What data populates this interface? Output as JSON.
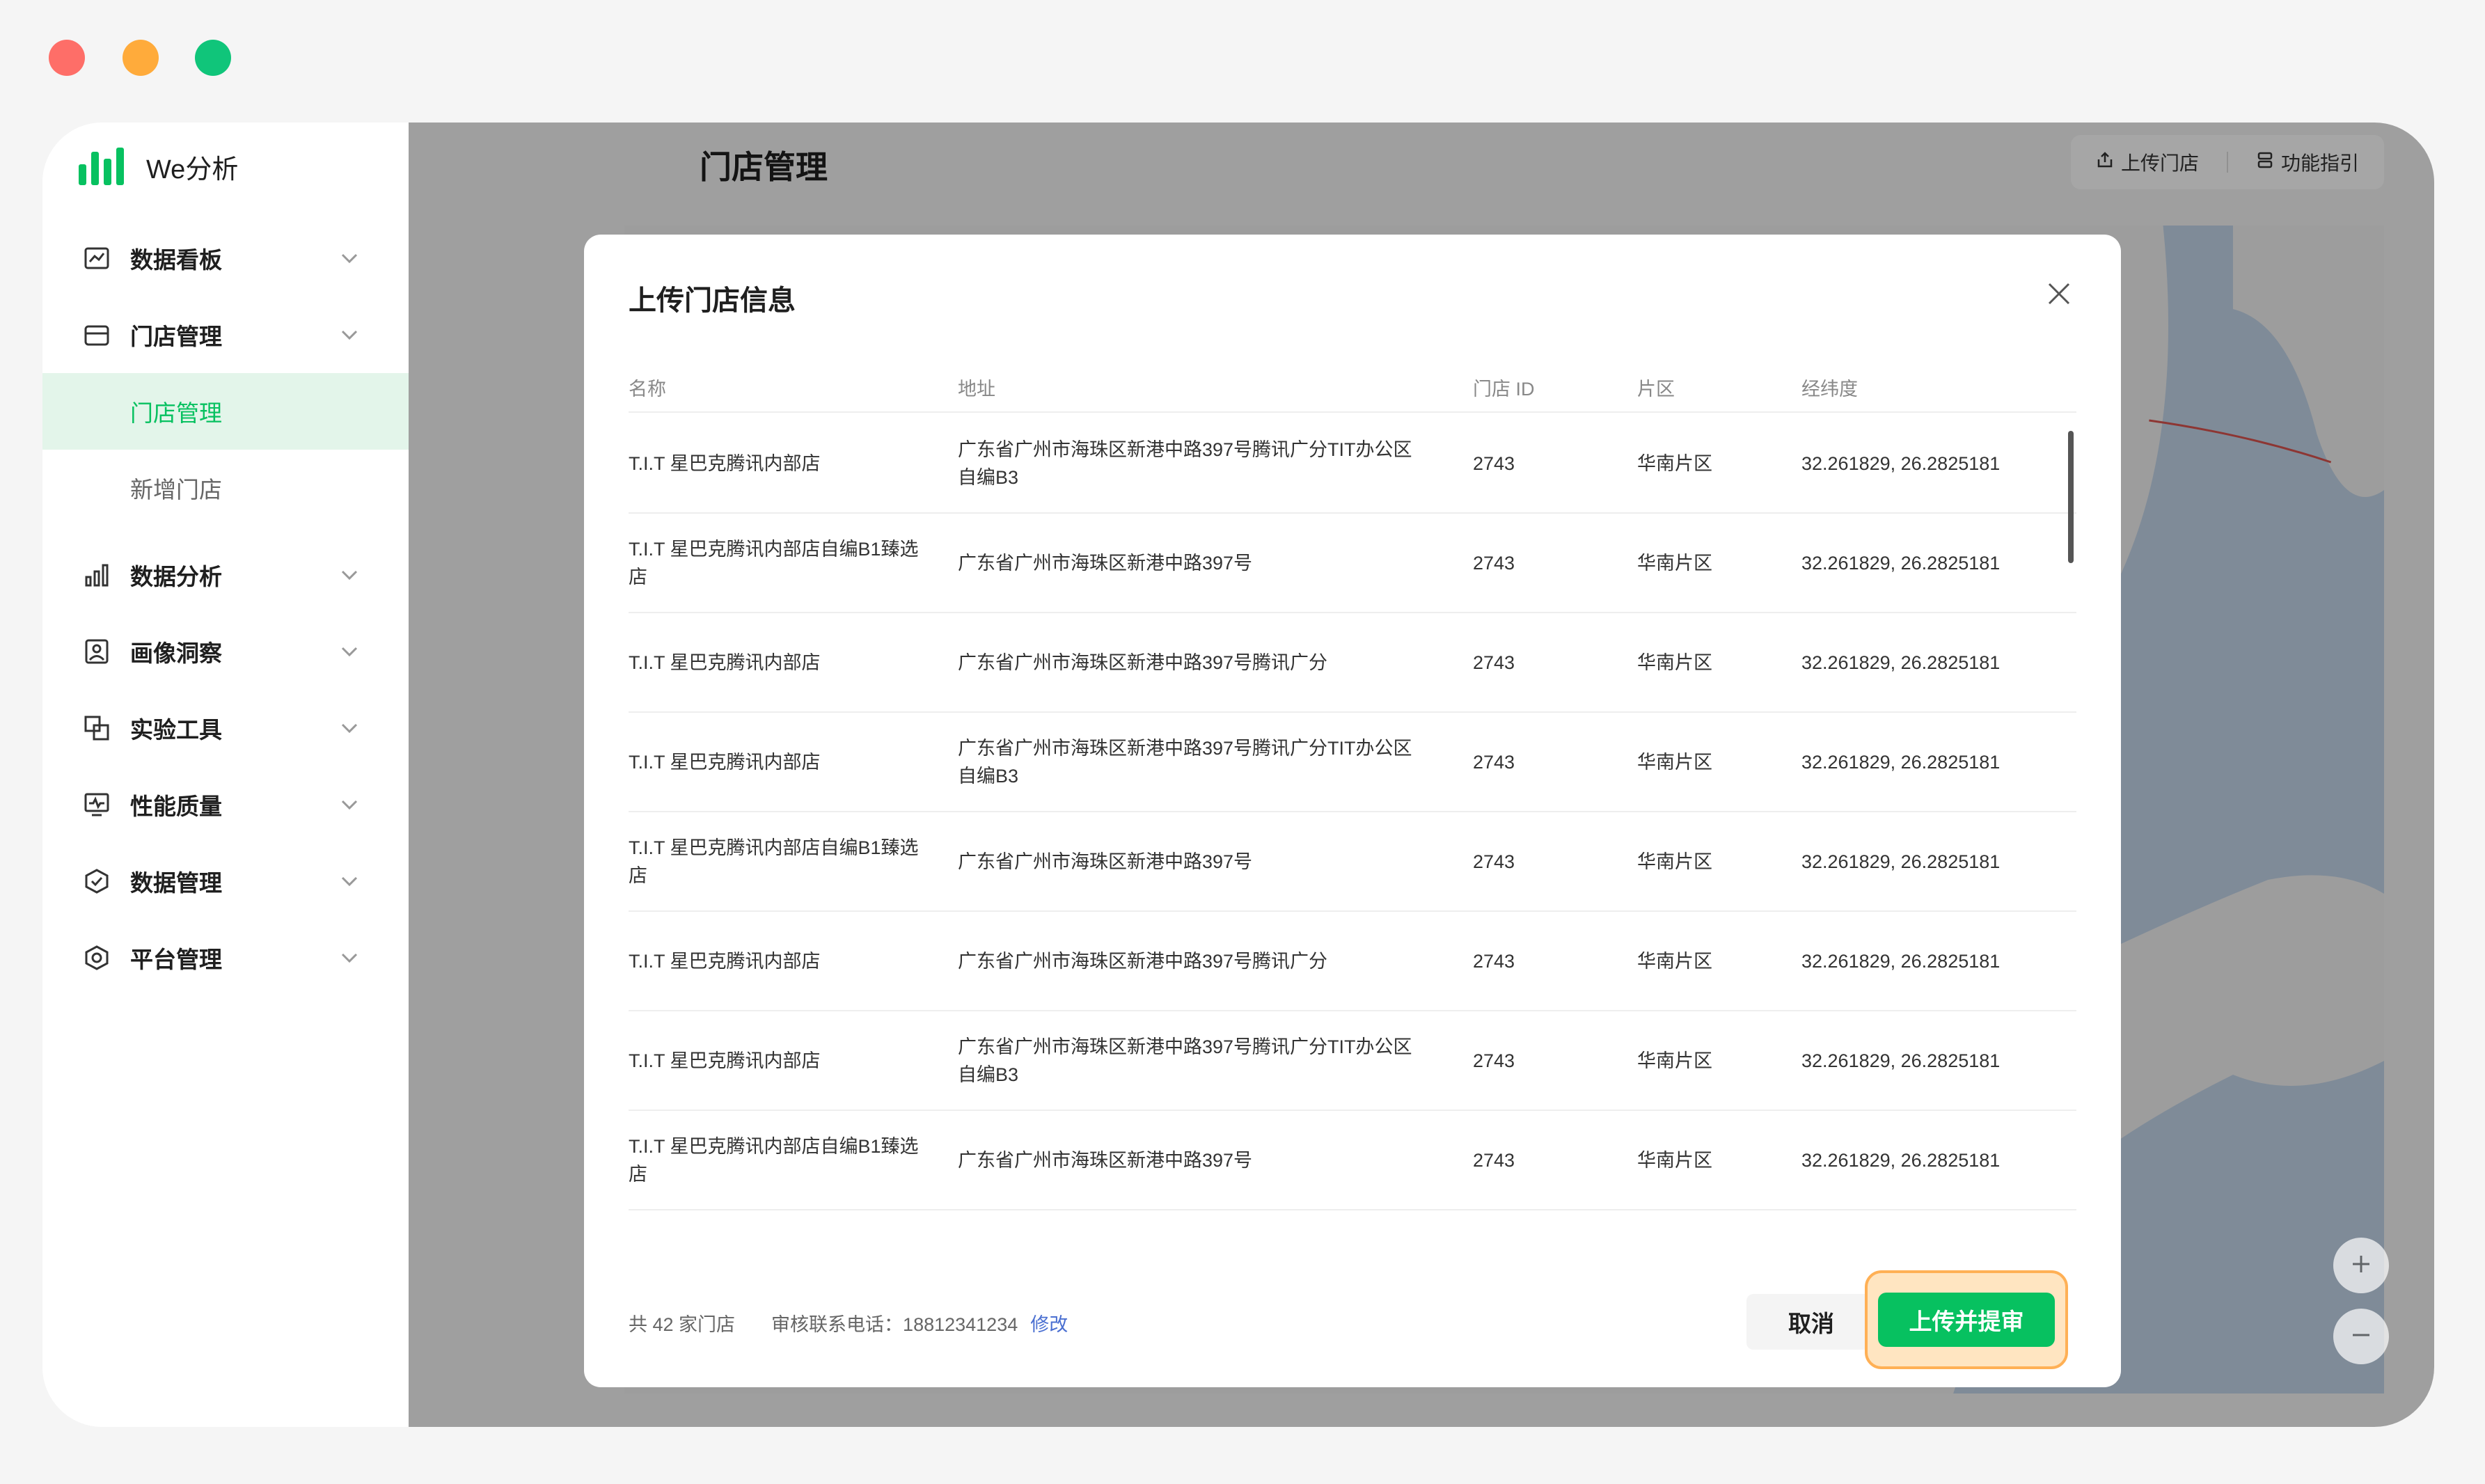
{
  "app": {
    "name": "We分析"
  },
  "sidebar": {
    "items": [
      {
        "label": "数据看板",
        "icon": "dashboard-icon"
      },
      {
        "label": "门店管理",
        "icon": "store-icon"
      },
      {
        "label": "数据分析",
        "icon": "bar-chart-icon"
      },
      {
        "label": "画像洞察",
        "icon": "portrait-icon"
      },
      {
        "label": "实验工具",
        "icon": "experiment-icon"
      },
      {
        "label": "性能质量",
        "icon": "monitor-icon"
      },
      {
        "label": "数据管理",
        "icon": "data-manage-icon"
      },
      {
        "label": "平台管理",
        "icon": "settings-icon"
      }
    ],
    "sub_items": [
      {
        "label": "门店管理",
        "active": true
      },
      {
        "label": "新增门店",
        "active": false
      }
    ]
  },
  "header": {
    "title": "门店管理",
    "upload_label": "上传门店",
    "guide_label": "功能指引"
  },
  "modal": {
    "title": "上传门店信息",
    "columns": [
      "名称",
      "地址",
      "门店 ID",
      "片区",
      "经纬度"
    ],
    "rows": [
      [
        "T.I.T 星巴克腾讯内部店",
        "广东省广州市海珠区新港中路397号腾讯广分TIT办公区 自编B3",
        "2743",
        "华南片区",
        "32.261829, 26.2825181"
      ],
      [
        "T.I.T 星巴克腾讯内部店自编B1臻选店",
        "广东省广州市海珠区新港中路397号",
        "2743",
        "华南片区",
        "32.261829, 26.2825181"
      ],
      [
        "T.I.T 星巴克腾讯内部店",
        "广东省广州市海珠区新港中路397号腾讯广分",
        "2743",
        "华南片区",
        "32.261829, 26.2825181"
      ],
      [
        "T.I.T 星巴克腾讯内部店",
        "广东省广州市海珠区新港中路397号腾讯广分TIT办公区 自编B3",
        "2743",
        "华南片区",
        "32.261829, 26.2825181"
      ],
      [
        "T.I.T 星巴克腾讯内部店自编B1臻选店",
        "广东省广州市海珠区新港中路397号",
        "2743",
        "华南片区",
        "32.261829, 26.2825181"
      ],
      [
        "T.I.T 星巴克腾讯内部店",
        "广东省广州市海珠区新港中路397号腾讯广分",
        "2743",
        "华南片区",
        "32.261829, 26.2825181"
      ],
      [
        "T.I.T 星巴克腾讯内部店",
        "广东省广州市海珠区新港中路397号腾讯广分TIT办公区 自编B3",
        "2743",
        "华南片区",
        "32.261829, 26.2825181"
      ],
      [
        "T.I.T 星巴克腾讯内部店自编B1臻选店",
        "广东省广州市海珠区新港中路397号",
        "2743",
        "华南片区",
        "32.261829, 26.2825181"
      ]
    ],
    "footer": {
      "count": "共 42 家门店",
      "phone_label": "审核联系电话：18812341234",
      "edit_label": "修改"
    },
    "cancel_label": "取消",
    "submit_label": "上传并提审"
  },
  "colors": {
    "accent": "#07c160",
    "highlight": "#ffb055"
  }
}
